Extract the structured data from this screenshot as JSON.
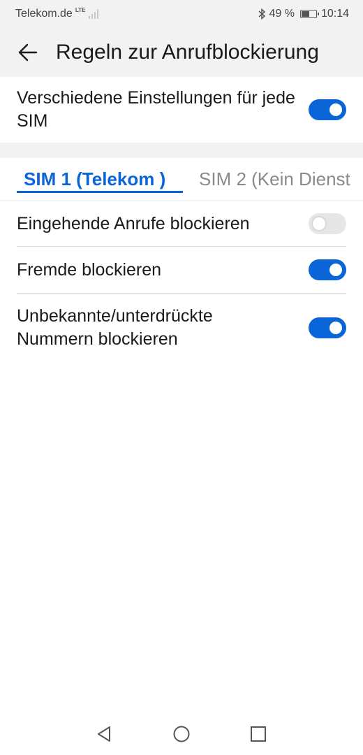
{
  "status_bar": {
    "carrier": "Telekom.de",
    "network_tag": "LTE",
    "battery_percent": "49 %",
    "battery_level": 0.49,
    "time": "10:14"
  },
  "app_bar": {
    "title": "Regeln zur Anrufblockierung"
  },
  "settings": {
    "different_per_sim": {
      "label": "Verschiedene Einstellungen für jede SIM",
      "enabled": true
    }
  },
  "tabs": [
    {
      "label": "SIM 1 (Telekom )",
      "active": true
    },
    {
      "label": "SIM 2 (Kein Dienst",
      "active": false
    }
  ],
  "rules": [
    {
      "label": "Eingehende Anrufe blockieren",
      "enabled": false
    },
    {
      "label": "Fremde blockieren",
      "enabled": true
    },
    {
      "label": "Unbekannte/unterdrückte Nummern blockieren",
      "enabled": true
    }
  ],
  "colors": {
    "accent": "#0a66d8",
    "toggle_off": "#e6e6e6",
    "background_gray": "#f2f2f2"
  },
  "icons": {
    "back": "arrow-left-icon",
    "nav_back": "triangle-back-icon",
    "nav_home": "circle-home-icon",
    "nav_recents": "square-recents-icon"
  }
}
